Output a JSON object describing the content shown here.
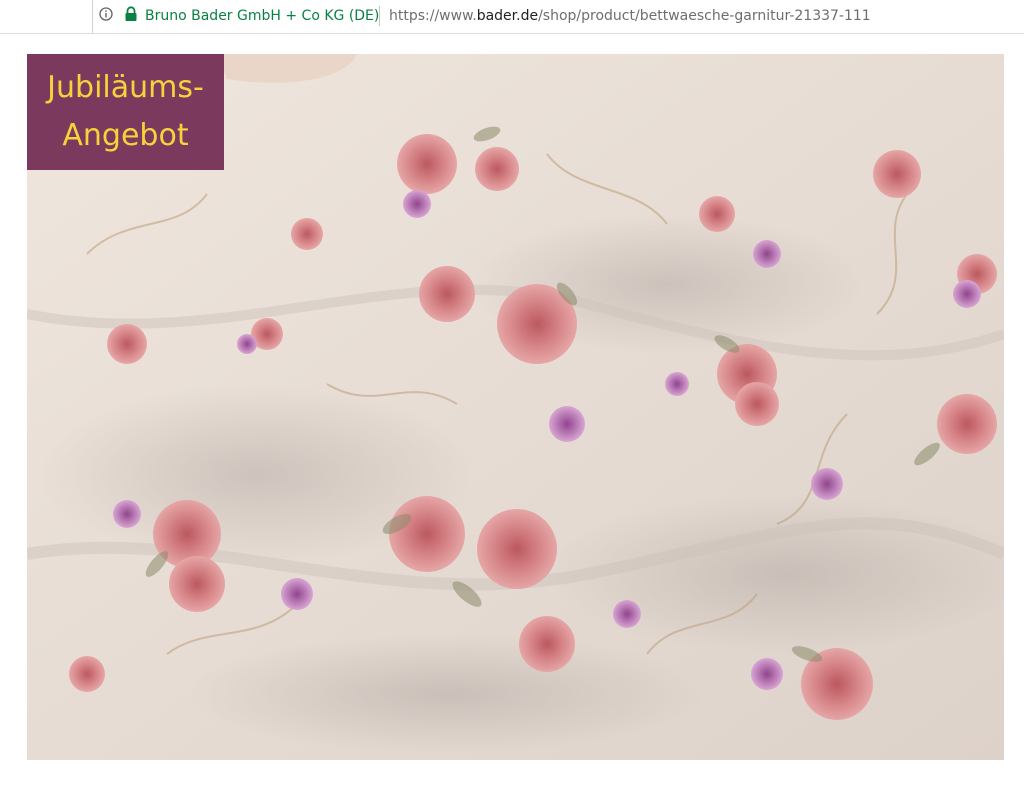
{
  "browser": {
    "site_identity": "Bruno Bader GmbH + Co KG (DE)",
    "url_prefix": "https://www.",
    "url_host": "bader.de",
    "url_path": "/shop/product/bettwaesche-garnitur-21337-111",
    "secure": true,
    "identity_color": "#0b8043"
  },
  "product": {
    "image_subject": "floral-bed-linen",
    "badge_line1": "Jubiläums-",
    "badge_line2": "Angebot",
    "badge_bg_color": "#7b3a5d",
    "badge_text_color": "#f5d33a"
  }
}
